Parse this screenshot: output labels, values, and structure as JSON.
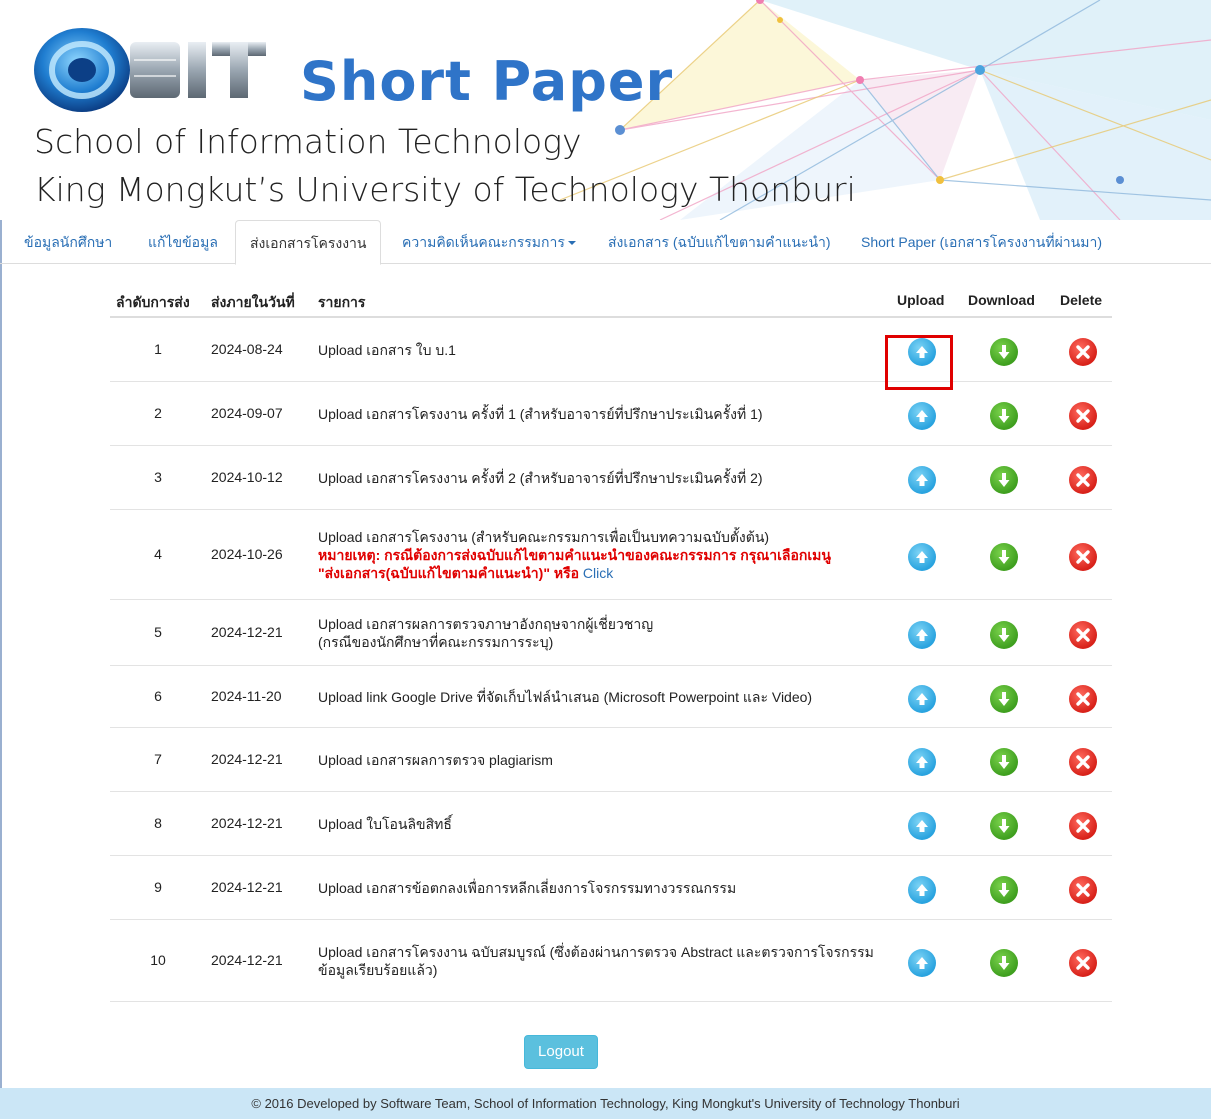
{
  "header": {
    "logo_text": "SIT",
    "brand_title": "Short Paper",
    "subtitle_line1": "School of Information Technology",
    "subtitle_line2": "King Mongkut’s University of Technology Thonburi"
  },
  "nav": {
    "items": [
      {
        "label": "ข้อมูลนักศึกษา"
      },
      {
        "label": "แก้ไขข้อมูล"
      },
      {
        "label": "ส่งเอกสารโครงงาน",
        "active": true
      },
      {
        "label": "ความคิดเห็นคณะกรรมการ",
        "dropdown": true
      },
      {
        "label": "ส่งเอกสาร (ฉบับแก้ไขตามคำแนะนำ)"
      },
      {
        "label": "Short Paper (เอกสารโครงงานที่ผ่านมา)"
      }
    ]
  },
  "table": {
    "headers": {
      "num": "ลำดับการส่ง",
      "date": "ส่งภายในวันที่",
      "desc": "รายการ",
      "upload": "Upload",
      "download": "Download",
      "delete": "Delete"
    },
    "rows": [
      {
        "num": "1",
        "date": "2024-08-24",
        "line1": "Upload เอกสาร ใบ บ.1"
      },
      {
        "num": "2",
        "date": "2024-09-07",
        "line1": "Upload เอกสารโครงงาน ครั้งที่ 1 (สำหรับอาจารย์ที่ปรึกษาประเมินครั้งที่ 1)"
      },
      {
        "num": "3",
        "date": "2024-10-12",
        "line1": "Upload เอกสารโครงงาน ครั้งที่ 2 (สำหรับอาจารย์ที่ปรึกษาประเมินครั้งที่ 2)"
      },
      {
        "num": "4",
        "date": "2024-10-26",
        "line1": "Upload เอกสารโครงงาน (สำหรับคณะกรรมการเพื่อเป็นบทความฉบับตั้งต้น)",
        "note_line1": "หมายเหตุ: กรณีต้องการส่งฉบับแก้ไขตามคำแนะนำของคณะกรรมการ กรุณาเลือกเมนู",
        "note_line2": "\"ส่งเอกสาร(ฉบับแก้ไขตามคำแนะนำ)\" หรือ ",
        "note_link": "Click"
      },
      {
        "num": "5",
        "date": "2024-12-21",
        "line1": "Upload เอกสารผลการตรวจภาษาอังกฤษจากผู้เชี่ยวชาญ",
        "line2": "(กรณีของนักศึกษาที่คณะกรรมการระบุ)"
      },
      {
        "num": "6",
        "date": "2024-11-20",
        "line1": "Upload link Google Drive ที่จัดเก็บไฟล์นำเสนอ (Microsoft Powerpoint และ Video)"
      },
      {
        "num": "7",
        "date": "2024-12-21",
        "line1": "Upload เอกสารผลการตรวจ plagiarism"
      },
      {
        "num": "8",
        "date": "2024-12-21",
        "line1": "Upload ใบโอนลิขสิทธิ์"
      },
      {
        "num": "9",
        "date": "2024-12-21",
        "line1": "Upload เอกสารข้อตกลงเพื่อการหลีกเลี่ยงการโจรกรรมทางวรรณกรรม"
      },
      {
        "num": "10",
        "date": "2024-12-21",
        "line1": "Upload เอกสารโครงงาน ฉบับสมบูรณ์ (ซึ่งต้องผ่านการตรวจ Abstract และตรวจการโจรกรรม",
        "line2": "ข้อมูลเรียบร้อยแล้ว)"
      }
    ]
  },
  "logout_label": "Logout",
  "footer_text": "© 2016 Developed by Software Team, School of Information Technology, King Mongkut's University of Technology Thonburi",
  "colors": {
    "brand": "#2f74c8",
    "link": "#2a6fb5",
    "upload": "#29a3df",
    "download": "#3f9f1f",
    "delete": "#d8221a",
    "note": "#e00000",
    "footer_bg": "#cbe6f6"
  }
}
